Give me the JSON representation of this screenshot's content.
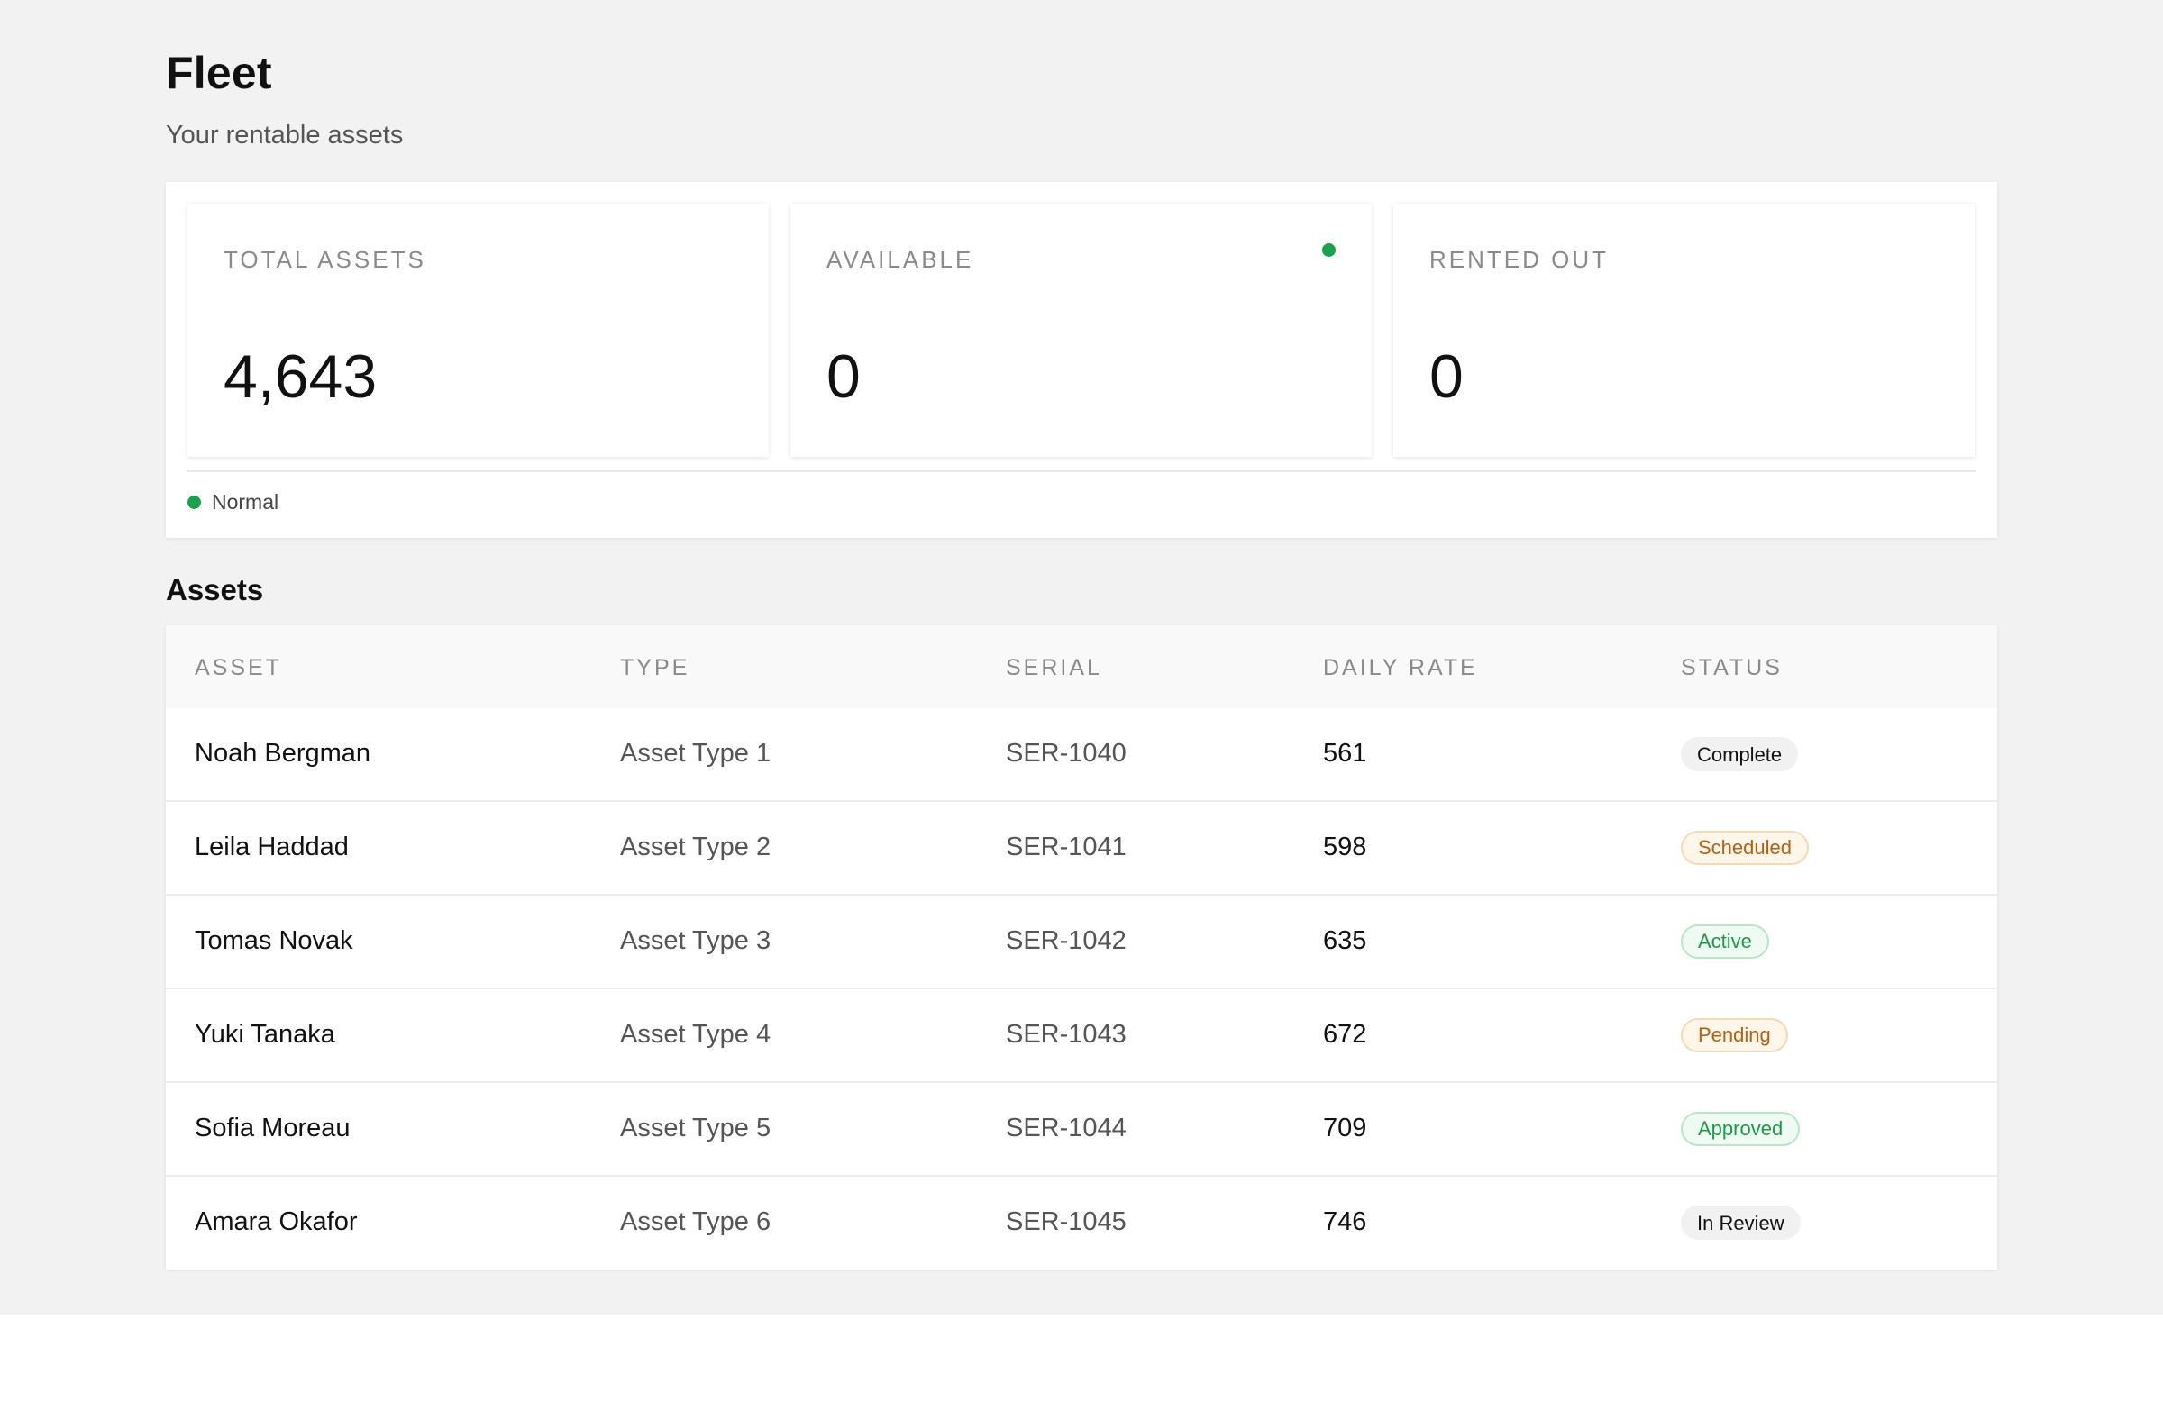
{
  "page": {
    "title": "Fleet",
    "subtitle": "Your rentable assets"
  },
  "stats": {
    "cards": [
      {
        "label": "TOTAL ASSETS",
        "value": "4,643",
        "has_indicator": false
      },
      {
        "label": "AVAILABLE",
        "value": "0",
        "has_indicator": true,
        "indicator_color": "#16a34a"
      },
      {
        "label": "RENTED OUT",
        "value": "0",
        "has_indicator": false
      }
    ],
    "status": {
      "text": "Normal",
      "color": "#16a34a"
    }
  },
  "assets": {
    "title": "Assets",
    "columns": [
      "ASSET",
      "TYPE",
      "SERIAL",
      "DAILY RATE",
      "STATUS"
    ],
    "rows": [
      {
        "asset": "Noah Bergman",
        "type": "Asset Type 1",
        "serial": "SER-1040",
        "daily_rate": "561",
        "status": "Complete",
        "status_tone": "neutral"
      },
      {
        "asset": "Leila Haddad",
        "type": "Asset Type 2",
        "serial": "SER-1041",
        "daily_rate": "598",
        "status": "Scheduled",
        "status_tone": "warn"
      },
      {
        "asset": "Tomas Novak",
        "type": "Asset Type 3",
        "serial": "SER-1042",
        "daily_rate": "635",
        "status": "Active",
        "status_tone": "ok"
      },
      {
        "asset": "Yuki Tanaka",
        "type": "Asset Type 4",
        "serial": "SER-1043",
        "daily_rate": "672",
        "status": "Pending",
        "status_tone": "warn"
      },
      {
        "asset": "Sofia Moreau",
        "type": "Asset Type 5",
        "serial": "SER-1044",
        "daily_rate": "709",
        "status": "Approved",
        "status_tone": "ok"
      },
      {
        "asset": "Amara Okafor",
        "type": "Asset Type 6",
        "serial": "SER-1045",
        "daily_rate": "746",
        "status": "In Review",
        "status_tone": "neutral"
      }
    ]
  },
  "colors": {
    "background": "#f2f2f2",
    "success": "#16a34a",
    "warning": "#b5610f"
  }
}
